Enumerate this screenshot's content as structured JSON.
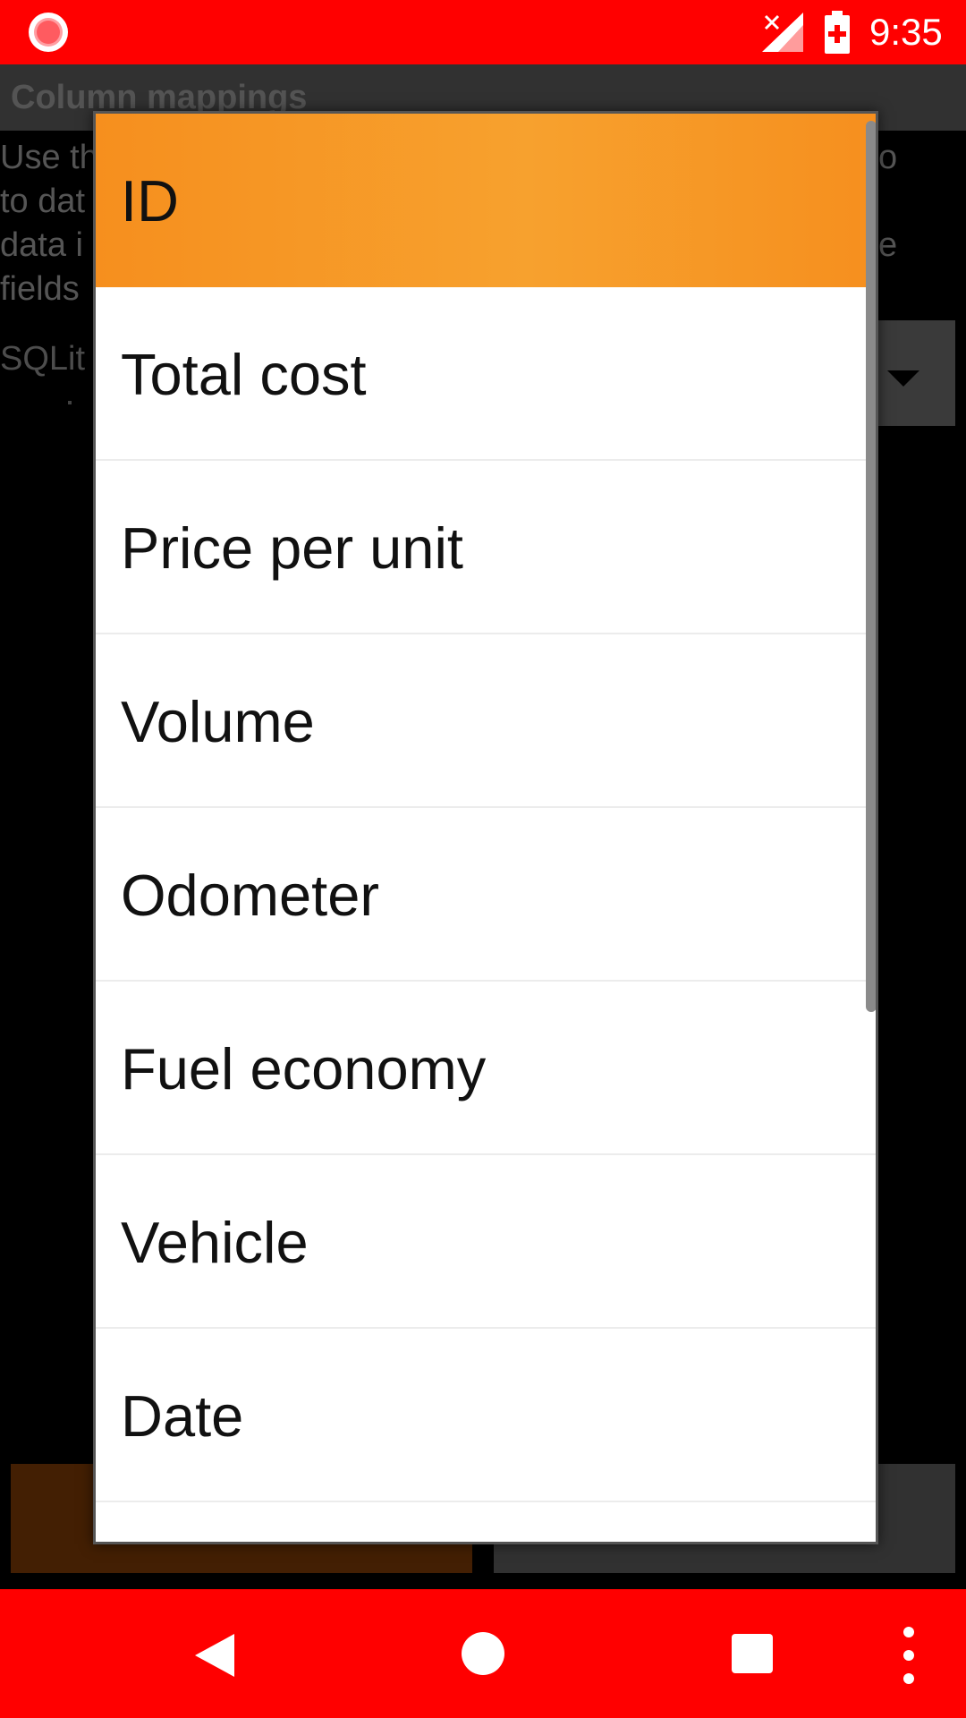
{
  "status_bar": {
    "time": "9:35",
    "icons": [
      "recording-icon",
      "no-signal-icon",
      "battery-charging-icon"
    ]
  },
  "background": {
    "title": "Column mappings",
    "description_lines": [
      "Use th",
      "to dat",
      "data i",
      "fields"
    ],
    "description_right_fragments": [
      "o",
      "",
      "e",
      ""
    ],
    "sqlite_label": "SQLit"
  },
  "dialog": {
    "options": [
      {
        "label": "ID",
        "selected": true
      },
      {
        "label": "Total cost",
        "selected": false
      },
      {
        "label": "Price per unit",
        "selected": false
      },
      {
        "label": "Volume",
        "selected": false
      },
      {
        "label": "Odometer",
        "selected": false
      },
      {
        "label": "Fuel economy",
        "selected": false
      },
      {
        "label": "Vehicle",
        "selected": false
      },
      {
        "label": "Date",
        "selected": false
      },
      {
        "label": "",
        "selected": false
      }
    ]
  },
  "colors": {
    "status_bar": "#ff0000",
    "nav_bar": "#ff0000",
    "selected_option": "#f6961f"
  },
  "nav_bar": {
    "icons": [
      "back-icon",
      "home-icon",
      "recents-icon",
      "overflow-menu-icon"
    ]
  }
}
